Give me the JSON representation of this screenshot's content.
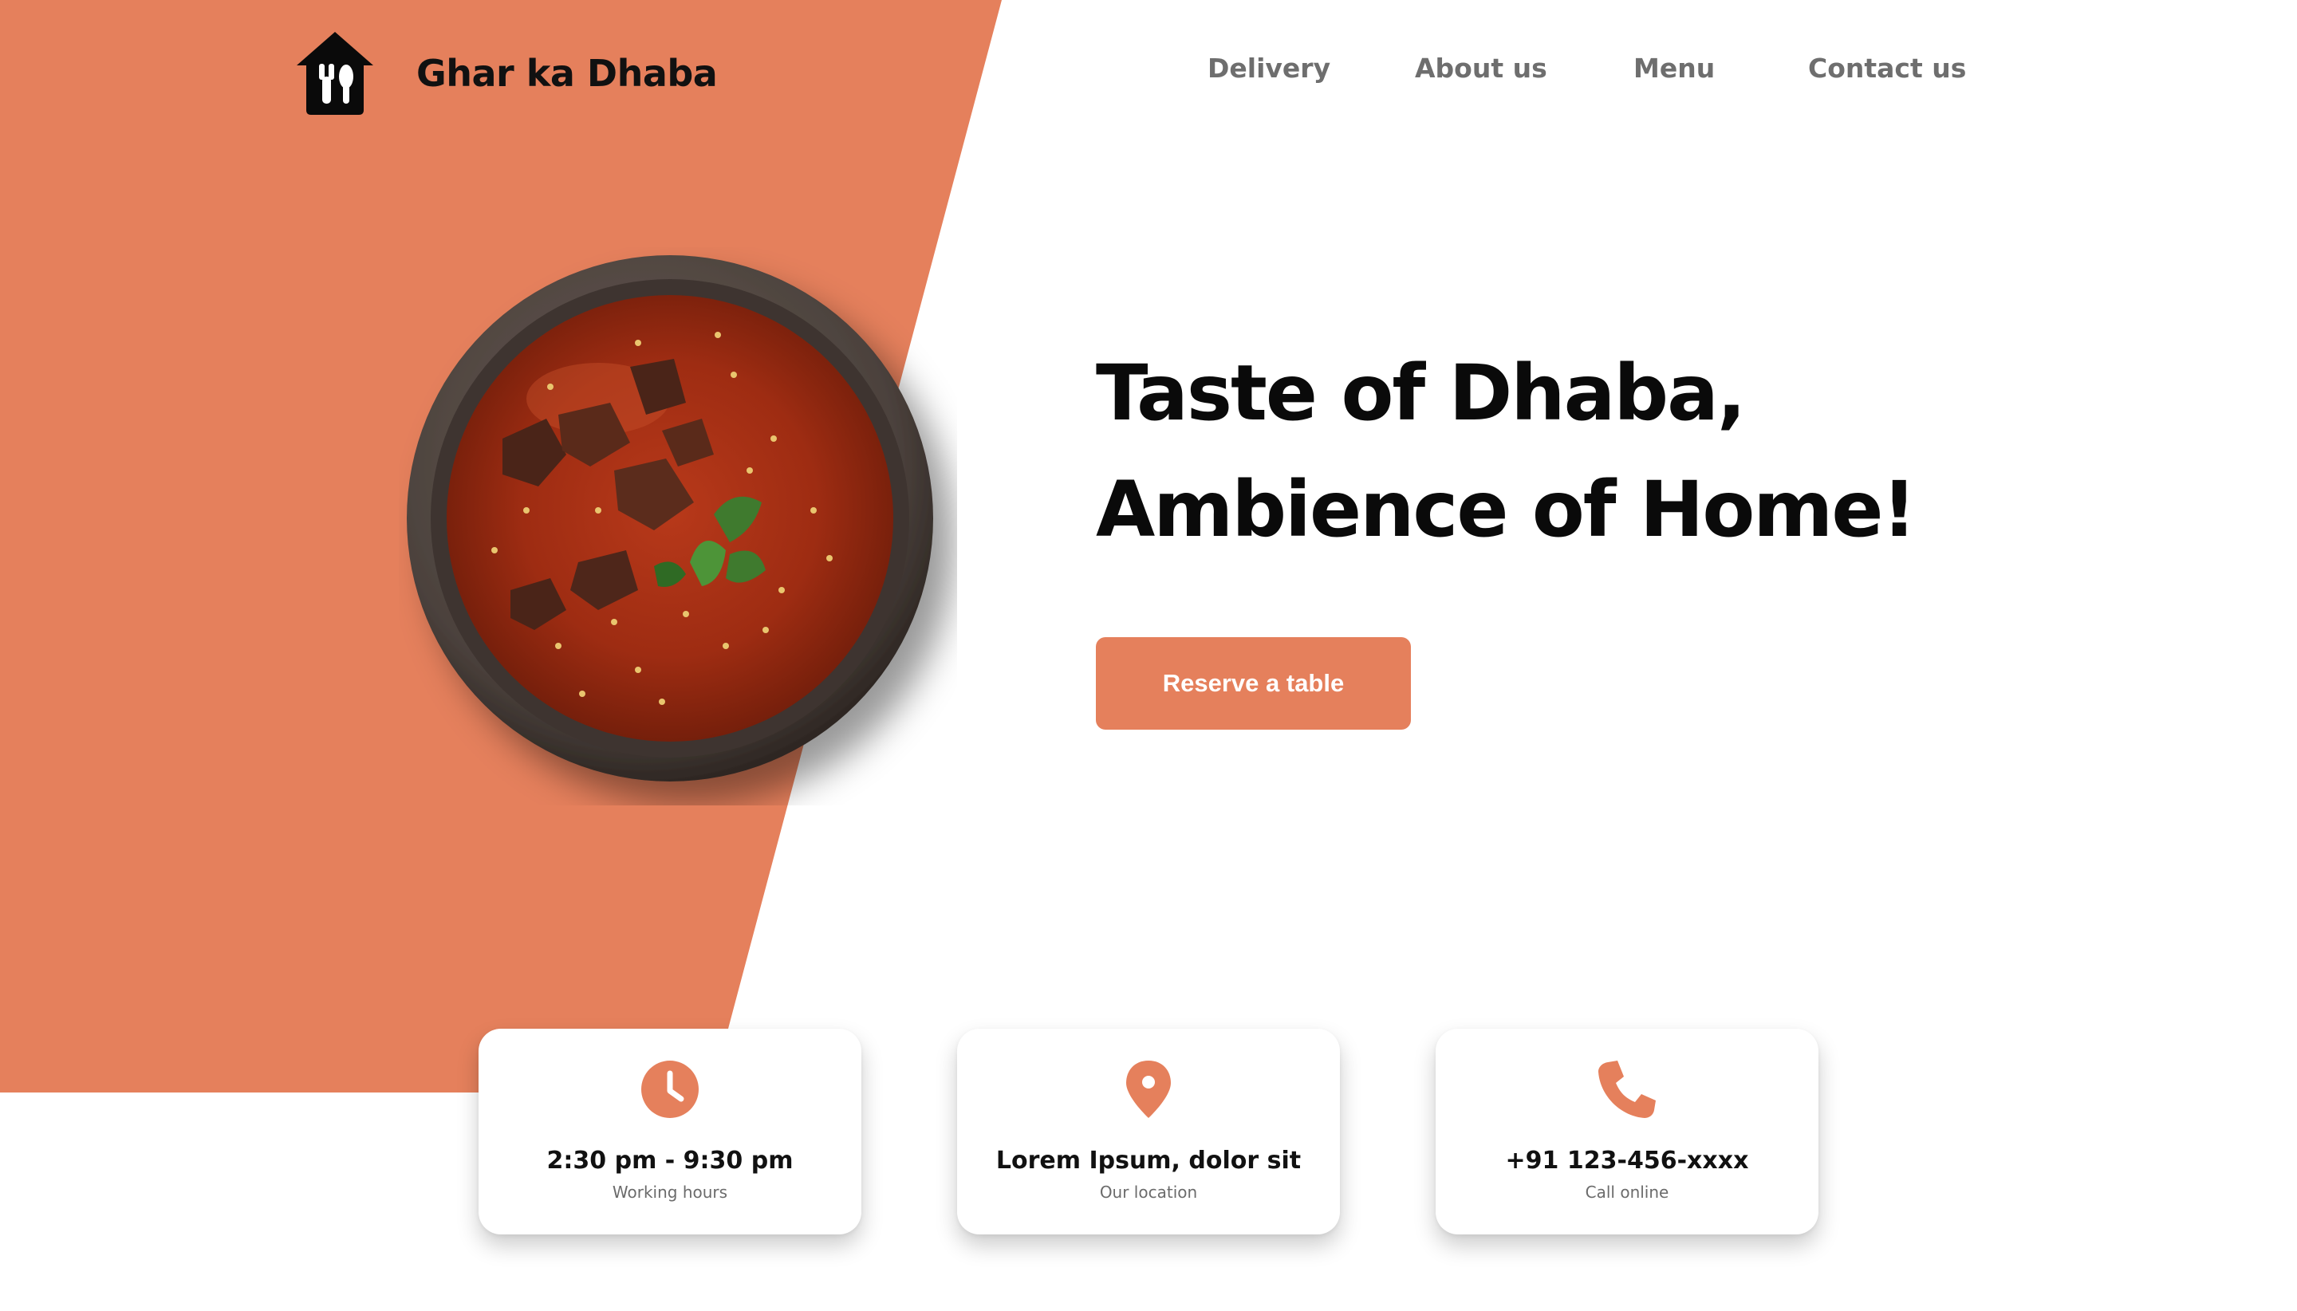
{
  "brand": {
    "name": "Ghar ka Dhaba",
    "logo_icon": "house-fork-spoon-icon"
  },
  "nav": {
    "items": [
      {
        "label": "Delivery"
      },
      {
        "label": "About us"
      },
      {
        "label": "Menu"
      },
      {
        "label": "Contact us"
      }
    ]
  },
  "hero": {
    "title_line1": "Taste of Dhaba,",
    "title_line2": "Ambience of Home!",
    "cta_label": "Reserve a table",
    "image": "curry-bowl-image"
  },
  "info_cards": [
    {
      "icon": "clock-icon",
      "value": "2:30 pm - 9:30 pm",
      "label": "Working hours"
    },
    {
      "icon": "location-pin-icon",
      "value": "Lorem Ipsum, dolor sit",
      "label": "Our location"
    },
    {
      "icon": "phone-icon",
      "value": "+91 123-456-xxxx",
      "label": "Call online"
    }
  ],
  "colors": {
    "accent": "#E5805C",
    "text_dark": "#111111",
    "nav_text": "#6E6E6E",
    "background": "#FFFFFF"
  }
}
